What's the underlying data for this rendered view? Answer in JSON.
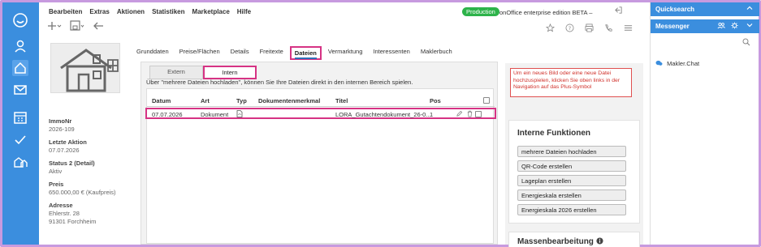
{
  "app": {
    "environment_badge": "Production",
    "edition": "onOffice enterprise edition BETA",
    "edition_suffix": "–",
    "menu": [
      "Bearbeiten",
      "Extras",
      "Aktionen",
      "Statistiken",
      "Marketplace",
      "Hilfe"
    ]
  },
  "property": {
    "fields": [
      {
        "label": "ImmoNr",
        "value": "2026-109"
      },
      {
        "label": "Letzte Aktion",
        "value": "07.07.2026"
      },
      {
        "label": "Status 2 (Detail)",
        "value": "Aktiv"
      },
      {
        "label": "Preis",
        "value": "650.000,00 € (Kaufpreis)"
      },
      {
        "label": "Adresse",
        "value": "Ehlerstr. 28",
        "value2": "91301 Forchheim"
      }
    ]
  },
  "tabs": [
    "Grunddaten",
    "Preise/Flächen",
    "Details",
    "Freitexte",
    "Dateien",
    "Vermarktung",
    "Interessenten",
    "Maklerbuch"
  ],
  "active_tab": "Dateien",
  "files": {
    "subtabs": [
      "Extern",
      "Intern"
    ],
    "active_subtab": "Intern",
    "note": "Über \"mehrere Dateien hochladen\", können Sie Ihre Dateien direkt in den internen Bereich spielen.",
    "columns": [
      "Datum",
      "Art",
      "Typ",
      "Dokumentenmerkmal",
      "Titel",
      "Pos"
    ],
    "rows": [
      {
        "datum": "07.07.2026",
        "art": "Dokument",
        "typ": "pdf-icon",
        "merkmal": "",
        "titel": "LORA_Gutachtendokument_26-0...",
        "pos": "1"
      }
    ]
  },
  "hint": "Um ein neues Bild oder eine neue Datei hochzuspielen, klicken Sie oben links in der Navigation auf das Plus-Symbol",
  "interne_funktionen": {
    "title": "Interne Funktionen",
    "buttons": [
      "mehrere Dateien hochladen",
      "QR-Code erstellen",
      "Lageplan erstellen",
      "Energieskala erstellen",
      "Energieskala 2026 erstellen"
    ]
  },
  "massenbearbeitung": {
    "title": "Massenbearbeitung"
  },
  "right_panel": {
    "quicksearch": "Quicksearch",
    "messenger": "Messenger",
    "chat_item": "Makler.Chat"
  },
  "colors": {
    "sidebar": "#3b8ede",
    "badge": "#2db34a",
    "highlight": "#d63384",
    "hint_red": "#d0302a"
  }
}
